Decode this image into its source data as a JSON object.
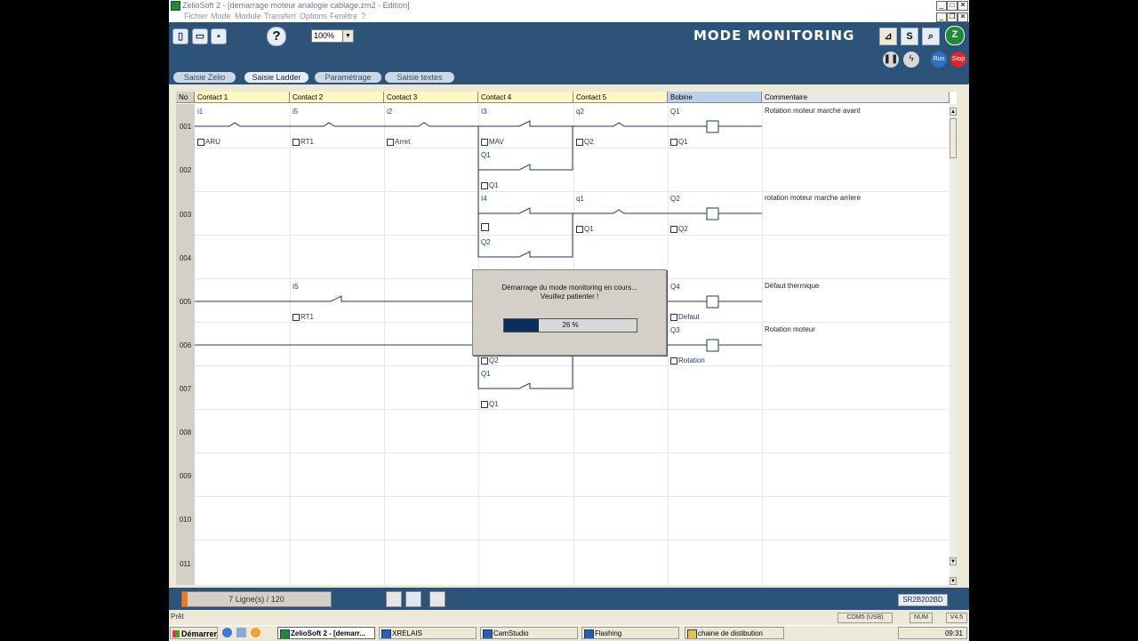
{
  "window": {
    "title": "ZelioSoft 2 - [demarrage moteur analogie cablage.zm2 - Edition]"
  },
  "menu": [
    "Fichier",
    "Mode",
    "Module",
    "Transfert",
    "Options",
    "Fenêtre",
    "?"
  ],
  "toolbar": {
    "zoom": "100%",
    "help": "?",
    "mode_title": "MODE MONITORING",
    "run": "Run",
    "stop": "Stop",
    "s_label": "S"
  },
  "tabs": [
    "Saisie Zelio",
    "Saisie Ladder",
    "Paramétrage",
    "Saisie textes"
  ],
  "grid": {
    "headers": [
      "No",
      "Contact 1",
      "Contact 2",
      "Contact 3",
      "Contact 4",
      "Contact 5",
      "Bobine",
      "Commentaire"
    ],
    "rows": [
      "001",
      "002",
      "003",
      "004",
      "005",
      "006",
      "007",
      "008",
      "009",
      "010",
      "011"
    ],
    "labels": {
      "r1": [
        "i1",
        "i5",
        "i2",
        "I3",
        "q2",
        "Q1"
      ],
      "r1b": [
        "ARU",
        "RT1",
        "Arret",
        "MAV",
        "Q2",
        "Q1"
      ],
      "r2": [
        "Q1",
        "Q1"
      ],
      "r3": [
        "I4",
        "q1",
        "Q2"
      ],
      "r3b": [
        "Q1",
        "Q2"
      ],
      "r4": [
        "Q2"
      ],
      "r5": [
        "I5",
        "Q4"
      ],
      "r5b": [
        "RT1",
        "Defaut"
      ],
      "r6": [
        "Q3",
        "Q2",
        "Rotation"
      ],
      "r7": [
        "Q1",
        "Q1"
      ]
    },
    "comments": [
      "Rotation moteur marche avant",
      "rotation moteur marche arriere",
      "Défaut thermique",
      "Rotation moteur"
    ]
  },
  "dialog": {
    "line1": "Démarrage du mode monitoring en cours...",
    "line2": "Veuillez patienter !",
    "progress_text": "26 %",
    "progress": 0.26
  },
  "bottom": {
    "lines": "7 Ligne(s) / 120",
    "model": "SR2B202BD"
  },
  "status": {
    "ready": "Prêt",
    "port": "COM5 (USB)",
    "num": "NUM",
    "version": "V4.5"
  },
  "taskbar": {
    "start": "Démarrer",
    "tasks": [
      "ZelioSoft 2 - [demarr...",
      "XRELAIS",
      "CamStudio",
      "Flashing",
      "chaine de distibution"
    ],
    "clock": "09:31"
  }
}
